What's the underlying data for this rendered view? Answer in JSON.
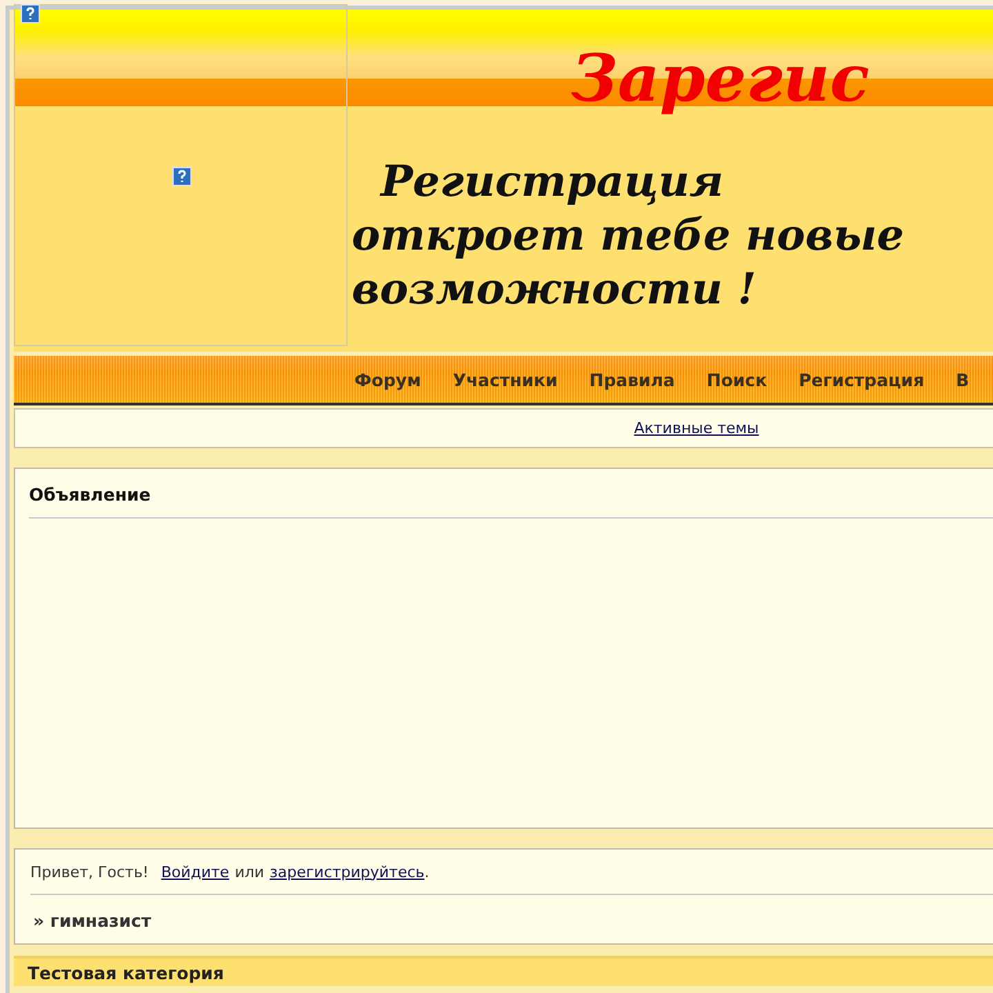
{
  "header": {
    "title": "Зарегис",
    "slogan_lines": [
      "Регистрация",
      "откроет тебе новые",
      "возможности !"
    ]
  },
  "nav": {
    "items": [
      {
        "label": "Форум"
      },
      {
        "label": "Участники"
      },
      {
        "label": "Правила"
      },
      {
        "label": "Поиск"
      },
      {
        "label": "Регистрация"
      },
      {
        "label": "В"
      }
    ]
  },
  "subnav": {
    "links": [
      "Активные темы"
    ]
  },
  "announcement": {
    "title": "Объявление"
  },
  "welcome": {
    "greeting": "Привет, Гость!",
    "login_link": "Войдите",
    "separator": "или",
    "register_link": "зарегистрируйтесь",
    "end": ".",
    "breadcrumb": "» гимназист"
  },
  "category": {
    "title": "Тестовая категория"
  }
}
